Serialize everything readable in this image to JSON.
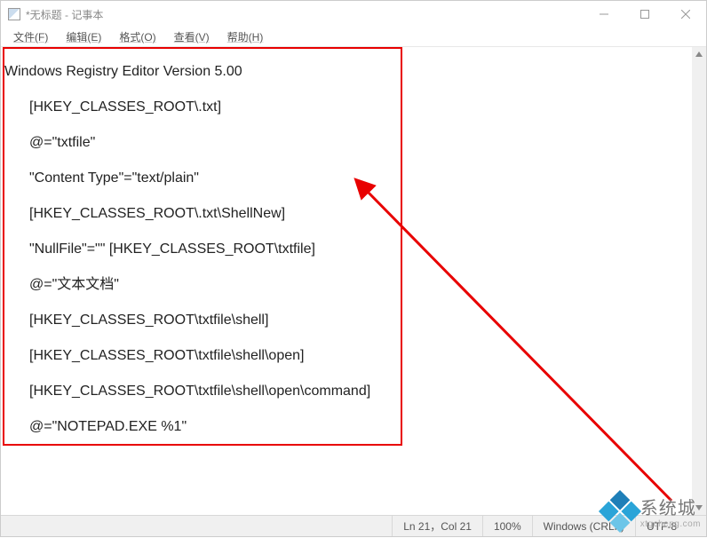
{
  "titlebar": {
    "title": "*无标题 - 记事本"
  },
  "menubar": {
    "items": [
      "文件(F)",
      "编辑(E)",
      "格式(O)",
      "查看(V)",
      "帮助(H)"
    ]
  },
  "content": {
    "lines": [
      {
        "text": "Windows Registry Editor Version 5.00",
        "indent": false
      },
      {
        "text": "[HKEY_CLASSES_ROOT\\.txt]",
        "indent": true
      },
      {
        "text": "@=\"txtfile\"",
        "indent": true
      },
      {
        "text": "\"Content Type\"=\"text/plain\"",
        "indent": true
      },
      {
        "text": "[HKEY_CLASSES_ROOT\\.txt\\ShellNew]",
        "indent": true
      },
      {
        "text": "\"NullFile\"=\"\" [HKEY_CLASSES_ROOT\\txtfile]",
        "indent": true
      },
      {
        "text": "@=\"文本文档\"",
        "indent": true
      },
      {
        "text": "[HKEY_CLASSES_ROOT\\txtfile\\shell]",
        "indent": true
      },
      {
        "text": "[HKEY_CLASSES_ROOT\\txtfile\\shell\\open]",
        "indent": true
      },
      {
        "text": "[HKEY_CLASSES_ROOT\\txtfile\\shell\\open\\command]",
        "indent": true
      },
      {
        "text": "@=\"NOTEPAD.EXE %1\"",
        "indent": true
      }
    ]
  },
  "statusbar": {
    "position": "Ln 21，Col 21",
    "zoom": "100%",
    "lineending": "Windows (CRLF)",
    "encoding": "UTF-8"
  },
  "watermark": {
    "text": "系统城",
    "sub": "xtgcheng.com"
  },
  "annotation": {
    "box_color": "#e80000",
    "arrow_color": "#e80000"
  }
}
